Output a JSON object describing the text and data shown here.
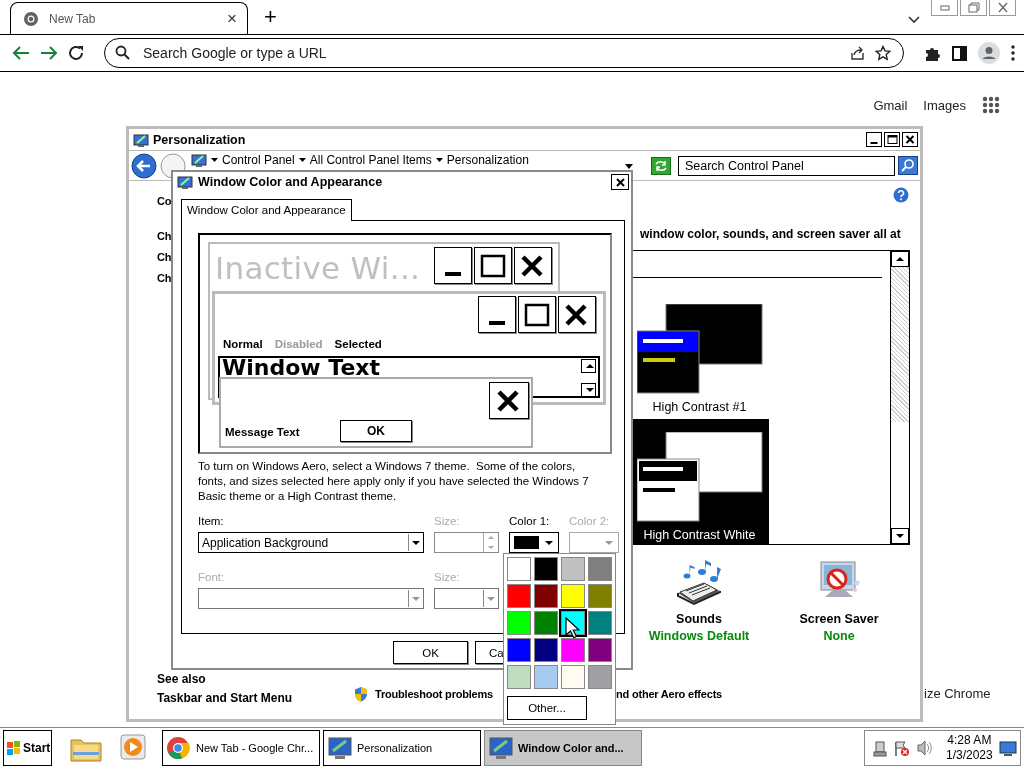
{
  "browser": {
    "tabs": [
      {
        "title": "New Tab",
        "close": "×",
        "selected": true
      }
    ],
    "new_tab": "+",
    "address": {
      "placeholder": "Search Google or type a URL"
    },
    "links": [
      "Gmail",
      "Images"
    ],
    "customize_fragment": "ize Chrome"
  },
  "personalization": {
    "title": "Personalization",
    "breadcrumb": [
      "Control Panel",
      "All Control Panel Items",
      "Personalization"
    ],
    "search": {
      "placeholder": "Search Control Panel"
    },
    "side_fragments": [
      "Co",
      "Ch",
      "Ch",
      "Ch"
    ],
    "intro_fragment": "window color, sounds, and screen saver all at",
    "themes": [
      {
        "name": "High Contrast #1",
        "kind": "hc1",
        "selected": false
      },
      {
        "name": "High Contrast White",
        "kind": "hcwhite",
        "selected": true
      }
    ],
    "settings": [
      {
        "kind": "sounds",
        "name": "Sounds",
        "value": "Windows Default"
      },
      {
        "kind": "screensaver",
        "name": "Screen Saver",
        "value": "None"
      }
    ],
    "see_also": {
      "heading": "See also",
      "links": [
        "Taskbar and Start Menu"
      ]
    },
    "footer_links": [
      "Troubleshoot problems",
      "nd other Aero effects"
    ]
  },
  "dialog": {
    "title": "Window Color and Appearance",
    "tabs": [
      {
        "label": "Window Color and Appearance",
        "selected": true
      }
    ],
    "preview": {
      "inactive_title": "Inactive Wi...",
      "menu": [
        {
          "label": "Normal",
          "disabled": false
        },
        {
          "label": "Disabled",
          "disabled": true
        },
        {
          "label": "Selected",
          "disabled": false
        }
      ],
      "window_text": "Window Text",
      "message": "Message Text",
      "ok": "OK"
    },
    "description": "To turn on Windows Aero, select a Windows 7 theme.  Some of the colors, fonts, and sizes selected here apply only if you have selected the Windows 7 Basic theme or a High Contrast theme.",
    "item": {
      "label": "Item:",
      "value": "Application Background",
      "disabled": false
    },
    "item_size": {
      "label": "Size:",
      "disabled": true
    },
    "color1": {
      "label": "Color 1:",
      "color": "#000000",
      "disabled": false
    },
    "color2": {
      "label": "Color 2:",
      "disabled": true
    },
    "font": {
      "label": "Font:",
      "disabled": true
    },
    "font_size": {
      "label": "Size:",
      "disabled": true
    },
    "buttons": [
      "OK",
      "Ca"
    ]
  },
  "palette": {
    "colors": [
      {
        "color": "#ffffff",
        "selected": false
      },
      {
        "color": "#000000",
        "selected": false
      },
      {
        "color": "#c0c0c0",
        "selected": false
      },
      {
        "color": "#808080",
        "selected": false
      },
      {
        "color": "#ff0000",
        "selected": false
      },
      {
        "color": "#800000",
        "selected": false
      },
      {
        "color": "#ffff00",
        "selected": false
      },
      {
        "color": "#808000",
        "selected": false
      },
      {
        "color": "#00ff00",
        "selected": false
      },
      {
        "color": "#008000",
        "selected": false
      },
      {
        "color": "#00ffff",
        "selected": true
      },
      {
        "color": "#008080",
        "selected": false
      },
      {
        "color": "#0000ff",
        "selected": false
      },
      {
        "color": "#000080",
        "selected": false
      },
      {
        "color": "#ff00ff",
        "selected": false
      },
      {
        "color": "#800080",
        "selected": false
      },
      {
        "color": "#c0dcc0",
        "selected": false
      },
      {
        "color": "#a6caf0",
        "selected": false
      },
      {
        "color": "#fffbf0",
        "selected": false
      },
      {
        "color": "#a0a0a4",
        "selected": false
      }
    ],
    "other": "Other..."
  },
  "taskbar": {
    "start": "Start",
    "tasks": [
      {
        "kind": "browser",
        "label": "New Tab - Google Chr...",
        "selected": false
      },
      {
        "kind": "control",
        "label": "Personalization",
        "selected": false
      },
      {
        "kind": "control",
        "label": "Window Color and...",
        "selected": true
      }
    ],
    "time": "4:28 AM",
    "date": "1/3/2023"
  }
}
